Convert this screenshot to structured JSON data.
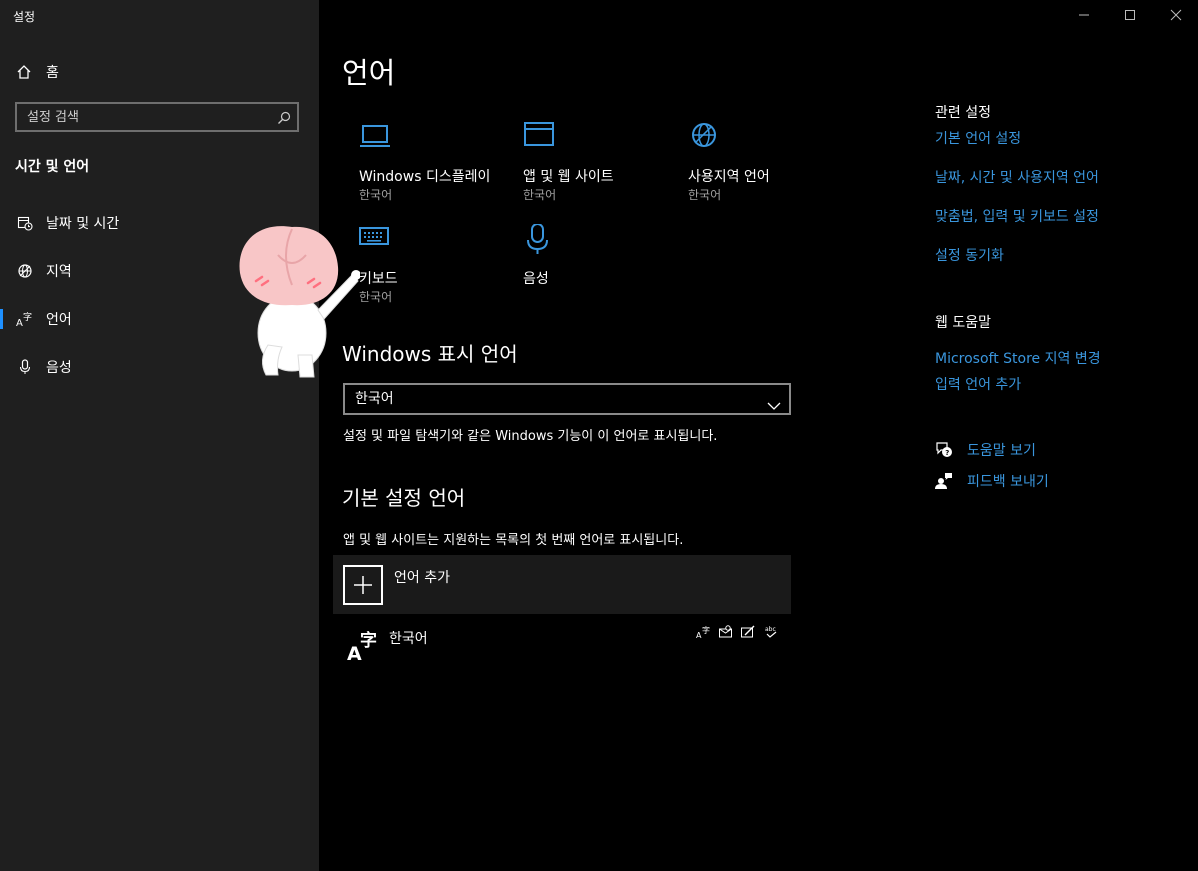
{
  "window": {
    "title": "설정"
  },
  "sidebar": {
    "home_label": "홈",
    "search_placeholder": "설정 검색",
    "section_title": "시간 및 언어",
    "items": [
      {
        "label": "날짜 및 시간",
        "icon": "calendar-clock-icon"
      },
      {
        "label": "지역",
        "icon": "globe-icon"
      },
      {
        "label": "언어",
        "icon": "language-icon",
        "active": true
      },
      {
        "label": "음성",
        "icon": "microphone-icon"
      }
    ]
  },
  "main": {
    "title": "언어",
    "tiles": [
      {
        "name": "Windows 디스플레이",
        "sub": "한국어",
        "icon": "laptop-icon"
      },
      {
        "name": "앱 및 웹 사이트",
        "sub": "한국어",
        "icon": "window-icon"
      },
      {
        "name": "사용지역 언어",
        "sub": "한국어",
        "icon": "globe-icon"
      },
      {
        "name": "키보드",
        "sub": "한국어",
        "icon": "keyboard-icon"
      },
      {
        "name": "음성",
        "sub": "",
        "icon": "microphone-icon"
      }
    ],
    "display_language": {
      "heading": "Windows 표시 언어",
      "selected": "한국어",
      "description": "설정 및 파일 탐색기와 같은 Windows 기능이 이 언어로 표시됩니다."
    },
    "preferred": {
      "heading": "기본 설정 언어",
      "description": "앱 및 웹 사이트는 지원하는 목록의 첫 번째 언어로 표시됩니다.",
      "add_label": "언어 추가",
      "languages": [
        {
          "name": "한국어"
        }
      ]
    }
  },
  "related": {
    "heading": "관련 설정",
    "links": [
      "기본 언어 설정",
      "날짜, 시간 및 사용지역 언어",
      "맞춤법, 입력 및 키보드 설정",
      "설정 동기화"
    ]
  },
  "web_help": {
    "heading": "웹 도움말",
    "links": [
      "Microsoft Store 지역 변경",
      "입력 언어 추가"
    ]
  },
  "help": {
    "get_help": "도움말 보기",
    "feedback": "피드백 보내기"
  },
  "colors": {
    "accent": "#3a96dd",
    "sidebar_bg": "#1f1f1f",
    "main_bg": "#000000"
  }
}
